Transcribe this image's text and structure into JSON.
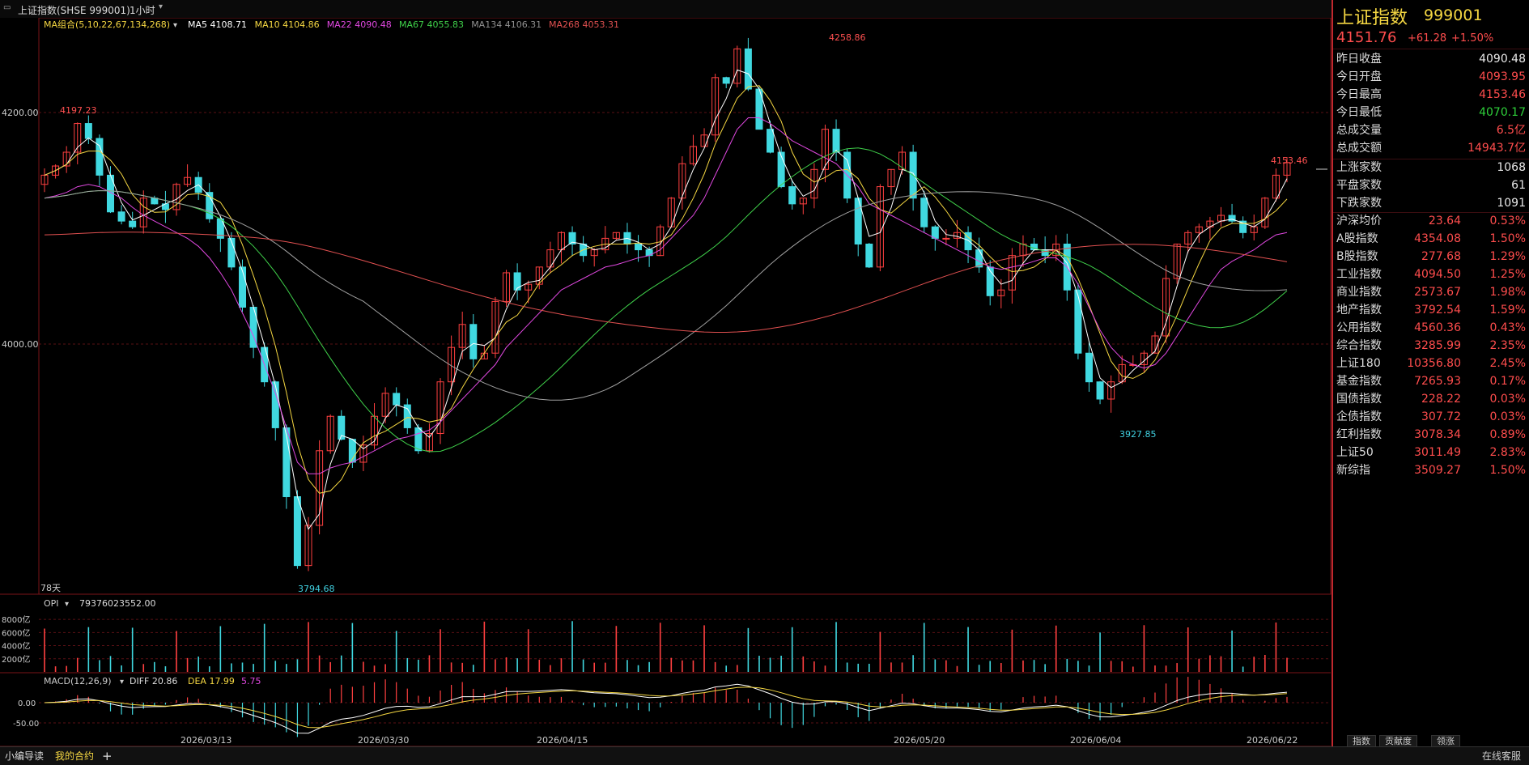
{
  "header": {
    "title": "上证指数(SHSE 999001)",
    "period": "1小时",
    "ma_group_label": "MA组合(5,10,22,67,134,268)",
    "ma": [
      {
        "label": "MA5 4108.71",
        "color": "#ffffff"
      },
      {
        "label": "MA10 4104.86",
        "color": "#f5d742"
      },
      {
        "label": "MA22 4090.48",
        "color": "#e048e0"
      },
      {
        "label": "MA67 4055.83",
        "color": "#3fd04a"
      },
      {
        "label": "MA134 4106.31",
        "color": "#909090"
      },
      {
        "label": "MA268 4053.31",
        "color": "#e05050"
      }
    ]
  },
  "main_chart": {
    "y_ticks": [
      "4200.00",
      "4000.00"
    ],
    "annotations": {
      "high": "4258.86",
      "left_high": "4197.23",
      "low": "3794.68",
      "mid_low": "3927.85",
      "last_high": "4153.46"
    },
    "days_label": "78天"
  },
  "chart_data": [
    {
      "type": "line",
      "title": "",
      "ylabel": "",
      "ylim": [
        3780,
        4270
      ],
      "x": [
        "2026/03/13",
        "2026/03/30",
        "2026/04/15",
        "2026/05/20",
        "2026/06/04",
        "2026/06/22"
      ],
      "key_points": [
        {
          "label": "4197.23",
          "value": 4197.23
        },
        {
          "label": "3794.68",
          "value": 3794.68
        },
        {
          "label": "4258.86",
          "value": 4258.86
        },
        {
          "label": "3927.85",
          "value": 3927.85
        },
        {
          "label": "4153.46",
          "value": 4153.46
        }
      ],
      "series_close": [
        4140,
        4148,
        4160,
        4185,
        4172,
        4140,
        4108,
        4100,
        4095,
        4120,
        4115,
        4110,
        4132,
        4138,
        4125,
        4102,
        4085,
        4060,
        4025,
        3990,
        3960,
        3920,
        3860,
        3800,
        3835,
        3900,
        3930,
        3910,
        3890,
        3905,
        3930,
        3950,
        3940,
        3920,
        3900,
        3915,
        3960,
        3990,
        4010,
        3980,
        3985,
        4030,
        4055,
        4040,
        4045,
        4060,
        4075,
        4090,
        4080,
        4070,
        4075,
        4085,
        4090,
        4080,
        4075,
        4070,
        4095,
        4120,
        4150,
        4165,
        4175,
        4225,
        4220,
        4250,
        4215,
        4180,
        4160,
        4130,
        4115,
        4120,
        4145,
        4180,
        4160,
        4120,
        4080,
        4060,
        4130,
        4145,
        4160,
        4120,
        4095,
        4085,
        4085,
        4090,
        4075,
        4060,
        4035,
        4040,
        4070,
        4080,
        4075,
        4070,
        4080,
        4040,
        3985,
        3960,
        3945,
        3960,
        3975,
        3975,
        3985,
        4000,
        4050,
        4080,
        4090,
        4095,
        4100,
        4105,
        4100,
        4090,
        4095,
        4120,
        4140,
        4151
      ],
      "series_ma22": [
        4120,
        4122,
        4125,
        4130,
        4132,
        4130,
        4125,
        4120,
        4112,
        4105,
        4100,
        4095,
        4090,
        4085,
        4078,
        4068,
        4055,
        4040,
        4020,
        4000,
        3975,
        3950,
        3920,
        3890,
        3880,
        3880,
        3885,
        3888,
        3890,
        3895,
        3900,
        3905,
        3910,
        3912,
        3915,
        3918,
        3925,
        3935,
        3945,
        3955,
        3965,
        3975,
        3990,
        4000,
        4010,
        4020,
        4030,
        4040,
        4045,
        4050,
        4055,
        4060,
        4062,
        4065,
        4068,
        4070,
        4075,
        4085,
        4095,
        4105,
        4120,
        4140,
        4160,
        4180,
        4190,
        4190,
        4185,
        4178,
        4170,
        4165,
        4160,
        4155,
        4150,
        4140,
        4130,
        4115,
        4110,
        4105,
        4100,
        4095,
        4090,
        4085,
        4080,
        4075,
        4070,
        4065,
        4060,
        4058,
        4060,
        4062,
        4065,
        4068,
        4068,
        4060,
        4045,
        4025,
        4005,
        3990,
        3980,
        3975,
        3972,
        3975,
        3985,
        4000,
        4015,
        4030,
        4045,
        4058,
        4065,
        4070,
        4075,
        4082,
        4088,
        4090
      ]
    },
    {
      "type": "bar",
      "title": "",
      "y_ticks": [
        "8000亿",
        "6000亿",
        "4000亿",
        "2000亿"
      ],
      "ylim": [
        0,
        9000
      ]
    },
    {
      "type": "bar",
      "title": "",
      "y_ticks": [
        "0.00",
        "-50.00"
      ],
      "ylim": [
        -70,
        40
      ]
    }
  ],
  "opi": {
    "label": "OPI",
    "value": "79376023552.00"
  },
  "macd": {
    "label": "MACD(12,26,9)",
    "diff": "DIFF 20.86",
    "dea": "DEA 17.99",
    "macd": "5.75"
  },
  "x_axis": [
    "2026/03/13",
    "2026/03/30",
    "2026/04/15",
    "2026/05/20",
    "2026/06/04",
    "2026/06/22"
  ],
  "quote": {
    "name": "上证指数",
    "code": "999001",
    "price": "4151.76",
    "change": "+61.28",
    "change_pct": "+1.50%",
    "stats": [
      {
        "k": "昨日收盘",
        "v": "4090.48",
        "c": "white"
      },
      {
        "k": "今日开盘",
        "v": "4093.95",
        "c": "red"
      },
      {
        "k": "今日最高",
        "v": "4153.46",
        "c": "red"
      },
      {
        "k": "今日最低",
        "v": "4070.17",
        "c": "green"
      },
      {
        "k": "总成交量",
        "v": "6.5亿",
        "c": "red"
      },
      {
        "k": "总成交额",
        "v": "14943.7亿",
        "c": "red"
      }
    ],
    "breadth": [
      {
        "k": "上涨家数",
        "v": "1068",
        "c": "white"
      },
      {
        "k": "平盘家数",
        "v": "61",
        "c": "white"
      },
      {
        "k": "下跌家数",
        "v": "1091",
        "c": "white"
      }
    ],
    "indices": [
      {
        "k": "沪深均价",
        "v": "23.64",
        "p": "0.53%"
      },
      {
        "k": "A股指数",
        "v": "4354.08",
        "p": "1.50%"
      },
      {
        "k": "B股指数",
        "v": "277.68",
        "p": "1.29%"
      },
      {
        "k": "工业指数",
        "v": "4094.50",
        "p": "1.25%"
      },
      {
        "k": "商业指数",
        "v": "2573.67",
        "p": "1.98%"
      },
      {
        "k": "地产指数",
        "v": "3792.54",
        "p": "1.59%"
      },
      {
        "k": "公用指数",
        "v": "4560.36",
        "p": "0.43%"
      },
      {
        "k": "综合指数",
        "v": "3285.99",
        "p": "2.35%"
      },
      {
        "k": "上证180",
        "v": "10356.80",
        "p": "2.45%"
      },
      {
        "k": "基金指数",
        "v": "7265.93",
        "p": "0.17%"
      },
      {
        "k": "国债指数",
        "v": "228.22",
        "p": "0.03%"
      },
      {
        "k": "企债指数",
        "v": "307.72",
        "p": "0.03%"
      },
      {
        "k": "红利指数",
        "v": "3078.34",
        "p": "0.89%"
      },
      {
        "k": "上证50",
        "v": "3011.49",
        "p": "2.83%"
      },
      {
        "k": "新综指",
        "v": "3509.27",
        "p": "1.50%"
      }
    ],
    "tabs": [
      "指数",
      "贡献度",
      "领涨"
    ]
  },
  "bottom": {
    "tabs": [
      "小编导读",
      "我的合约"
    ],
    "plus": "+",
    "right": "在线客服"
  }
}
